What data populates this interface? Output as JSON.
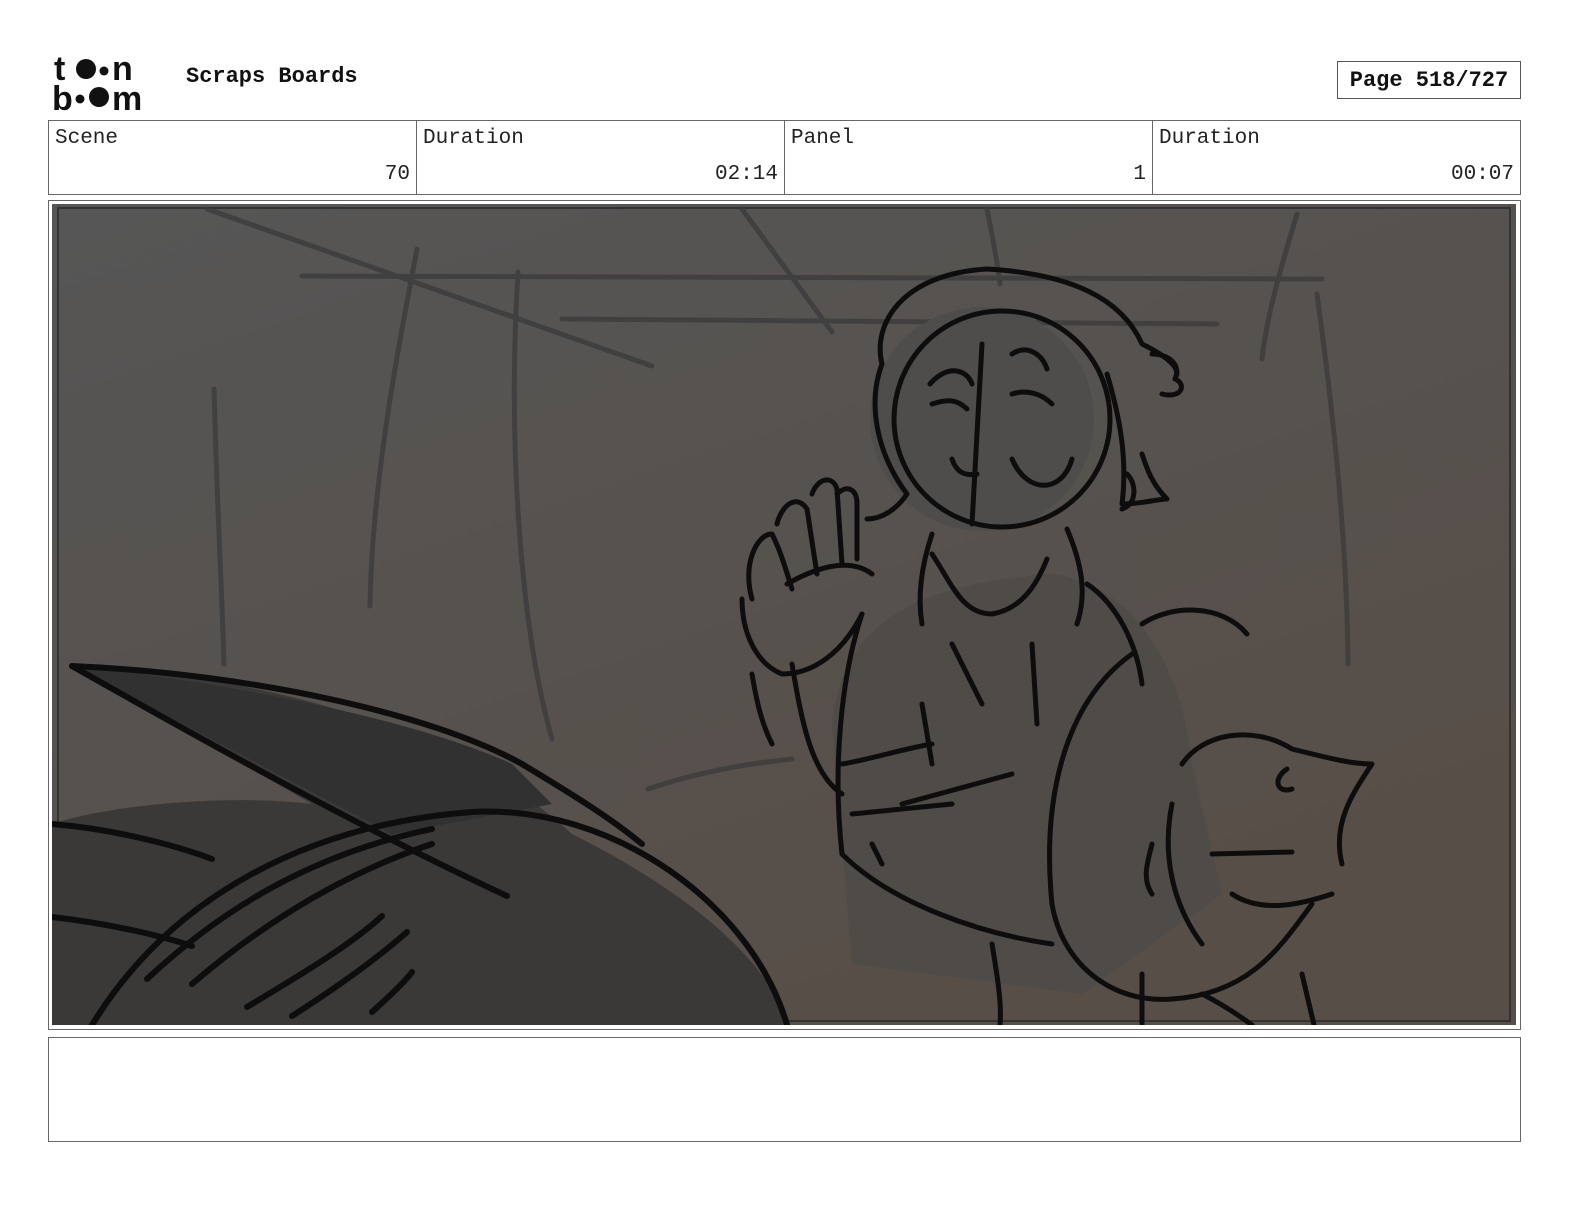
{
  "logo": {
    "line1": "toon",
    "line2": "boom"
  },
  "header": {
    "title": "Scraps Boards",
    "page": "Page 518/727"
  },
  "info": [
    {
      "label": "Scene",
      "value": "70"
    },
    {
      "label": "Duration",
      "value": "02:14"
    },
    {
      "label": "Panel",
      "value": "1"
    },
    {
      "label": "Duration",
      "value": "00:07"
    }
  ],
  "panel": {
    "description_icon": "storyboard-sketch-image",
    "colors": {
      "background": "#545250",
      "car": "#3b3938",
      "ink": "#111111"
    }
  },
  "notes": {
    "text": ""
  }
}
